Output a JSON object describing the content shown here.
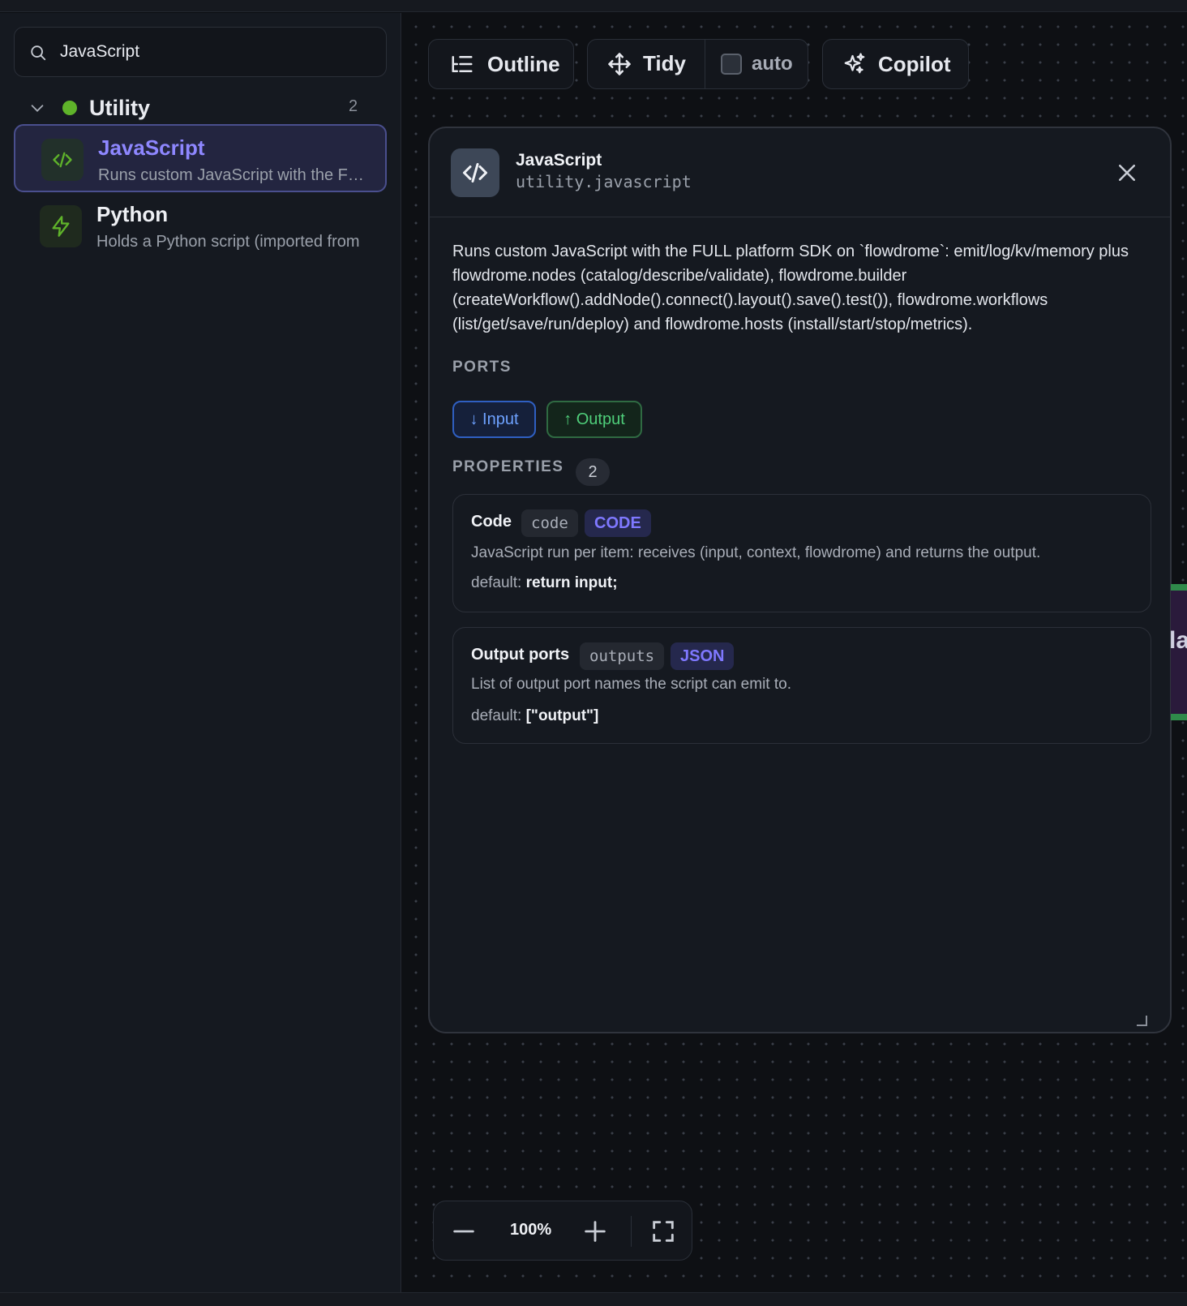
{
  "sidebar": {
    "search": {
      "value": "JavaScript",
      "icon": "search-icon"
    },
    "group": {
      "label": "Utility",
      "count": "2",
      "status_color": "#5fb32a"
    },
    "items": [
      {
        "title": "JavaScript",
        "desc": "Runs custom JavaScript with the FULL platform SDK on `flowdrome`",
        "icon": "code-icon",
        "selected": true
      },
      {
        "title": "Python",
        "desc": "Holds a Python script (imported from",
        "icon": "bolt-icon",
        "selected": false
      }
    ]
  },
  "toolbar": {
    "outline_label": "Outline",
    "tidy_label": "Tidy",
    "auto_label": "auto",
    "auto_checked": false,
    "copilot_label": "Copilot"
  },
  "detail": {
    "name": "JavaScript",
    "type": "utility.javascript",
    "summary": "Runs custom JavaScript with the FULL platform SDK on `flowdrome`: emit/log/kv/memory plus flowdrome.nodes (catalog/describe/validate), flowdrome.builder (createWorkflow().addNode().connect().layout().save().test()), flowdrome.workflows (list/get/save/run/deploy) and flowdrome.hosts (install/start/stop/metrics).",
    "ports_title": "PORTS",
    "ports": {
      "input": "↓ Input",
      "output": "↑ Output"
    },
    "properties_title": "PROPERTIES",
    "properties_count": "2",
    "properties": [
      {
        "name": "Code",
        "key": "code",
        "kind": "CODE",
        "desc": "JavaScript run per item: receives (input, context, flowdrome) and returns the output.",
        "default_label": "default:",
        "default_value": "return input;"
      },
      {
        "name": "Output ports",
        "key": "outputs",
        "kind": "JSON",
        "desc": "List of output port names the script can emit to.",
        "default_label": "default:",
        "default_value": "[\"output\"]"
      }
    ]
  },
  "zoom": {
    "level": "100%"
  },
  "edge_node_text": "la",
  "colors": {
    "accent": "#8e87ff",
    "input_port": "#6ea2ff",
    "output_port": "#4fce7a"
  }
}
